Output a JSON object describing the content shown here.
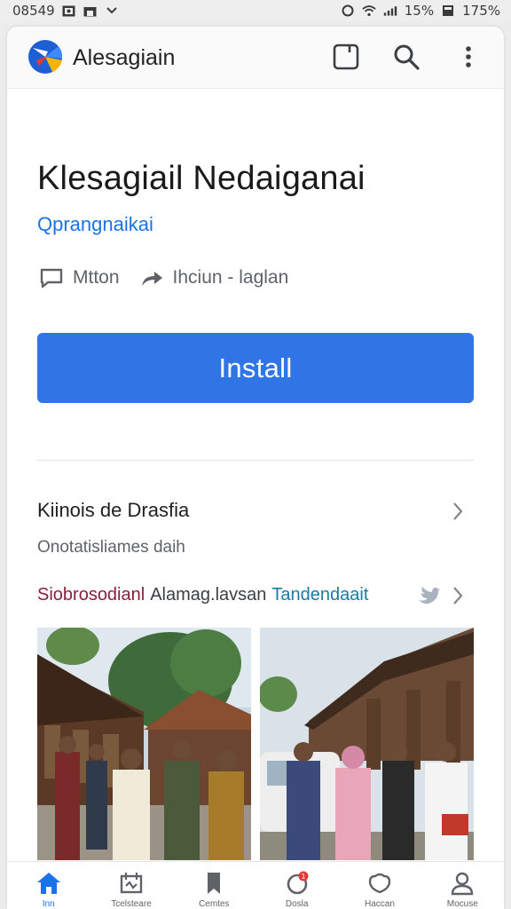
{
  "status_bar": {
    "time": "08549",
    "battery_percent": "15%",
    "right_value": "175%"
  },
  "app_bar": {
    "title": "Alesagiain"
  },
  "app": {
    "title": "Klesagiail Nedaiganai",
    "developer": "Qprangnaikai",
    "meta_items": [
      "Mtton",
      "Ihciun - laglan"
    ],
    "install_label": "Install"
  },
  "section": {
    "title": "Kiinois de Drasfia",
    "subtitle": "Onotatisliames daih",
    "tag_a": "Siobrosodianl",
    "tag_b": "Alamag.lavsan",
    "tag_c": "Tandendaait"
  },
  "bottom_nav": {
    "items": [
      {
        "label": "Inn",
        "icon": "home-icon"
      },
      {
        "label": "Tcelsteare",
        "icon": "apps-icon"
      },
      {
        "label": "Cemtes",
        "icon": "bookmark-icon"
      },
      {
        "label": "Dosla",
        "icon": "notification-icon"
      },
      {
        "label": "Haccan",
        "icon": "gift-icon"
      },
      {
        "label": "Mocuse",
        "icon": "account-icon"
      }
    ]
  },
  "colors": {
    "accent": "#2f75e6",
    "link": "#1a73e8",
    "tag_red": "#8a1f3a",
    "tag_teal": "#1a7aa8"
  }
}
